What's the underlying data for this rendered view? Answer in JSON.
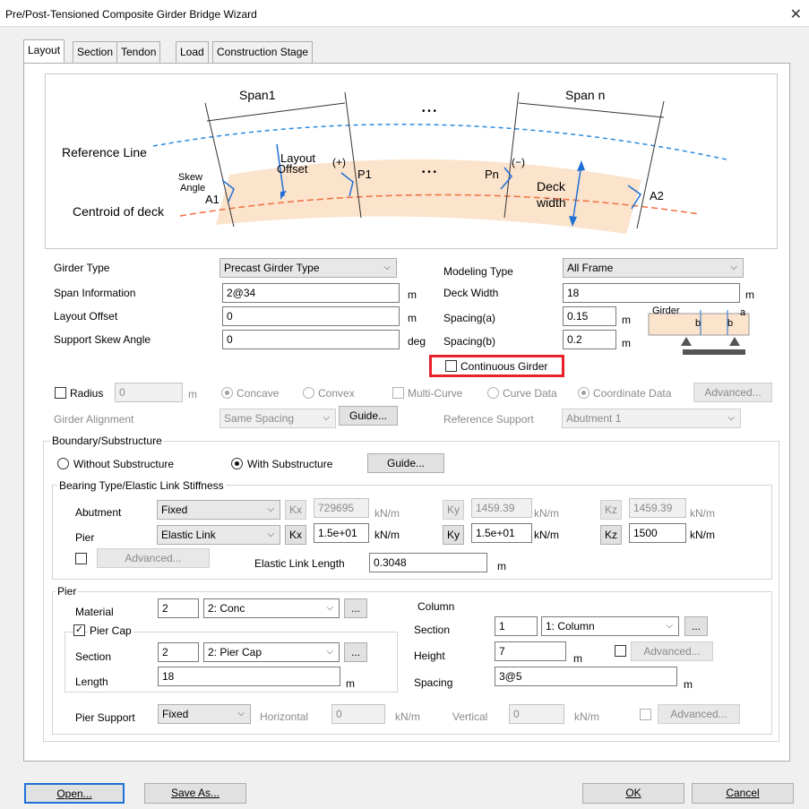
{
  "window": {
    "title": "Pre/Post-Tensioned Composite Girder Bridge Wizard"
  },
  "tabs": [
    "Layout",
    "Section",
    "Tendon",
    "Load",
    "Construction Stage"
  ],
  "diagram": {
    "span1": "Span1",
    "span_n": "Span n",
    "dots": "• • •",
    "reference_line": "Reference Line",
    "centroid": "Centroid of deck",
    "skew": "Skew",
    "angle": "Angle",
    "layout": "Layout",
    "offset": "Offset",
    "plus": "(+)",
    "minus": "(−)",
    "a1": "A1",
    "p1": "P1",
    "pn": "Pn",
    "a2": "A2",
    "deck": "Deck",
    "width": "width"
  },
  "left_fields": {
    "girder_type_label": "Girder Type",
    "girder_type_value": "Precast Girder Type",
    "span_info_label": "Span Information",
    "span_info_value": "2@34",
    "span_info_unit": "m",
    "layout_offset_label": "Layout Offset",
    "layout_offset_value": "0",
    "layout_offset_unit": "m",
    "skew_label": "Support Skew Angle",
    "skew_value": "0",
    "skew_unit": "deg"
  },
  "right_fields": {
    "modeling_type_label": "Modeling Type",
    "modeling_type_value": "All Frame",
    "deck_width_label": "Deck Width",
    "deck_width_value": "18",
    "deck_width_unit": "m",
    "spacing_a_label": "Spacing(a)",
    "spacing_a_value": "0.15",
    "spacing_a_unit": "m",
    "spacing_b_label": "Spacing(b)",
    "spacing_b_value": "0.2",
    "spacing_b_unit": "m",
    "mini_girder": "Girder",
    "mini_a": "a",
    "mini_b": "b"
  },
  "continuous_girder": {
    "label": "Continuous Girder",
    "checked": false
  },
  "radius_row": {
    "radius_label": "Radius",
    "radius_value": "0",
    "radius_unit": "m",
    "concave": "Concave",
    "convex": "Convex",
    "multi_curve": "Multi-Curve",
    "curve_data": "Curve Data",
    "coordinate_data": "Coordinate Data",
    "advanced": "Advanced..."
  },
  "alignment_row": {
    "girder_alignment_label": "Girder Alignment",
    "girder_alignment_value": "Same Spacing",
    "guide": "Guide...",
    "reference_support_label": "Reference Support",
    "reference_support_value": "Abutment 1"
  },
  "boundary": {
    "title": "Boundary/Substructure",
    "without": "Without Substructure",
    "with": "With Substructure",
    "guide": "Guide...",
    "bearing_title": "Bearing Type/Elastic Link Stiffness",
    "abutment_label": "Abutment",
    "abutment_type": "Fixed",
    "abutment_kx": "729695",
    "abutment_ky": "1459.39",
    "abutment_kz": "1459.39",
    "pier_label": "Pier",
    "pier_type": "Elastic Link",
    "pier_kx": "1.5e+01",
    "pier_ky": "1.5e+01",
    "pier_kz": "1500",
    "kx": "Kx",
    "ky": "Ky",
    "kz": "Kz",
    "unit": "kN/m",
    "advanced": "Advanced...",
    "elastic_link_length_label": "Elastic Link Length",
    "elastic_link_length_value": "0.3048",
    "elastic_link_length_unit": "m"
  },
  "pier": {
    "title": "Pier",
    "material_label": "Material",
    "material_id": "2",
    "material_value": "2: Conc",
    "pier_cap_label": "Pier Cap",
    "pier_cap_checked": true,
    "section_label": "Section",
    "section_id": "2",
    "section_value": "2: Pier Cap",
    "length_label": "Length",
    "length_value": "18",
    "length_unit": "m",
    "column_title": "Column",
    "col_section_label": "Section",
    "col_section_id": "1",
    "col_section_value": "1: Column",
    "height_label": "Height",
    "height_value": "7",
    "height_unit": "m",
    "spacing_label": "Spacing",
    "spacing_value": "3@5",
    "spacing_unit": "m",
    "col_advanced": "Advanced...",
    "pier_support_label": "Pier Support",
    "pier_support_value": "Fixed",
    "horizontal_label": "Horizontal",
    "horizontal_value": "0",
    "horizontal_unit": "kN/m",
    "vertical_label": "Vertical",
    "vertical_value": "0",
    "vertical_unit": "kN/m",
    "support_advanced": "Advanced...",
    "ellipsis": "..."
  },
  "buttons": {
    "open": "Open...",
    "save_as": "Save As...",
    "ok": "OK",
    "cancel": "Cancel"
  },
  "colors": {
    "highlight": "#e8202a",
    "deck_fill": "#fbe3cc",
    "reference_line": "#2b8ae0",
    "centroid_line": "#f07040",
    "offset_arrow": "#1f6fd6"
  }
}
